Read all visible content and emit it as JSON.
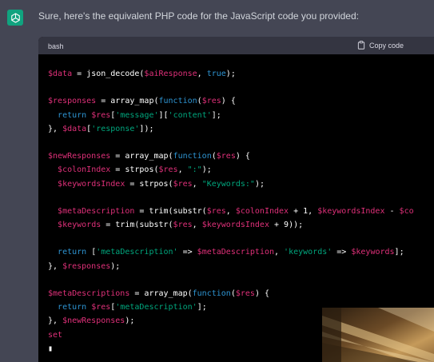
{
  "message": {
    "intro_text": "Sure, here's the equivalent PHP code for the JavaScript code you provided:"
  },
  "codeblock": {
    "language": "bash",
    "copy_label": "Copy code",
    "lines": [
      [
        [
          "var",
          "$data"
        ],
        [
          "plain",
          " = json_decode("
        ],
        [
          "var",
          "$aiResponse"
        ],
        [
          "plain",
          ", "
        ],
        [
          "kw",
          "true"
        ],
        [
          "plain",
          ");"
        ]
      ],
      [],
      [
        [
          "var",
          "$responses"
        ],
        [
          "plain",
          " = array_map("
        ],
        [
          "kw",
          "function"
        ],
        [
          "plain",
          "("
        ],
        [
          "var",
          "$res"
        ],
        [
          "plain",
          ") {"
        ]
      ],
      [
        [
          "plain",
          "  "
        ],
        [
          "kw",
          "return"
        ],
        [
          "plain",
          " "
        ],
        [
          "var",
          "$res"
        ],
        [
          "plain",
          "["
        ],
        [
          "str",
          "'message'"
        ],
        [
          "plain",
          "]["
        ],
        [
          "str",
          "'content'"
        ],
        [
          "plain",
          "];"
        ]
      ],
      [
        [
          "plain",
          "}, "
        ],
        [
          "var",
          "$data"
        ],
        [
          "plain",
          "["
        ],
        [
          "str",
          "'response'"
        ],
        [
          "plain",
          "]);"
        ]
      ],
      [],
      [
        [
          "var",
          "$newResponses"
        ],
        [
          "plain",
          " = array_map("
        ],
        [
          "kw",
          "function"
        ],
        [
          "plain",
          "("
        ],
        [
          "var",
          "$res"
        ],
        [
          "plain",
          ") {"
        ]
      ],
      [
        [
          "plain",
          "  "
        ],
        [
          "var",
          "$colonIndex"
        ],
        [
          "plain",
          " = strpos("
        ],
        [
          "var",
          "$res"
        ],
        [
          "plain",
          ", "
        ],
        [
          "str",
          "\":\""
        ],
        [
          "plain",
          ");"
        ]
      ],
      [
        [
          "plain",
          "  "
        ],
        [
          "var",
          "$keywordsIndex"
        ],
        [
          "plain",
          " = strpos("
        ],
        [
          "var",
          "$res"
        ],
        [
          "plain",
          ", "
        ],
        [
          "str",
          "\"Keywords:\""
        ],
        [
          "plain",
          ");"
        ]
      ],
      [],
      [
        [
          "plain",
          "  "
        ],
        [
          "var",
          "$metaDescription"
        ],
        [
          "plain",
          " = trim(substr("
        ],
        [
          "var",
          "$res"
        ],
        [
          "plain",
          ", "
        ],
        [
          "var",
          "$colonIndex"
        ],
        [
          "plain",
          " + 1, "
        ],
        [
          "var",
          "$keywordsIndex"
        ],
        [
          "plain",
          " - "
        ],
        [
          "var",
          "$co"
        ]
      ],
      [
        [
          "plain",
          "  "
        ],
        [
          "var",
          "$keywords"
        ],
        [
          "plain",
          " = trim(substr("
        ],
        [
          "var",
          "$res"
        ],
        [
          "plain",
          ", "
        ],
        [
          "var",
          "$keywordsIndex"
        ],
        [
          "plain",
          " + 9));"
        ]
      ],
      [],
      [
        [
          "plain",
          "  "
        ],
        [
          "kw",
          "return"
        ],
        [
          "plain",
          " ["
        ],
        [
          "str",
          "'metaDescription'"
        ],
        [
          "plain",
          " => "
        ],
        [
          "var",
          "$metaDescription"
        ],
        [
          "plain",
          ", "
        ],
        [
          "str",
          "'keywords'"
        ],
        [
          "plain",
          " => "
        ],
        [
          "var",
          "$keywords"
        ],
        [
          "plain",
          "];"
        ]
      ],
      [
        [
          "plain",
          "}, "
        ],
        [
          "var",
          "$responses"
        ],
        [
          "plain",
          ");"
        ]
      ],
      [],
      [
        [
          "var",
          "$metaDescriptions"
        ],
        [
          "plain",
          " = array_map("
        ],
        [
          "kw",
          "function"
        ],
        [
          "plain",
          "("
        ],
        [
          "var",
          "$res"
        ],
        [
          "plain",
          ") {"
        ]
      ],
      [
        [
          "plain",
          "  "
        ],
        [
          "kw",
          "return"
        ],
        [
          "plain",
          " "
        ],
        [
          "var",
          "$res"
        ],
        [
          "plain",
          "["
        ],
        [
          "str",
          "'metaDescription'"
        ],
        [
          "plain",
          "];"
        ]
      ],
      [
        [
          "plain",
          "}, "
        ],
        [
          "var",
          "$newResponses"
        ],
        [
          "plain",
          ");"
        ]
      ],
      [
        [
          "var",
          "set"
        ]
      ],
      [
        [
          "cursor",
          "▮"
        ]
      ]
    ]
  },
  "colors": {
    "page_background": "#444654",
    "avatar_green": "#10a37f",
    "code_background": "#000000",
    "header_background": "#343541",
    "variable": "#df3079",
    "keyword": "#2e95d3",
    "string": "#00a67d"
  },
  "icons": {
    "avatar": "openai-logo-icon",
    "copy": "clipboard-icon"
  }
}
